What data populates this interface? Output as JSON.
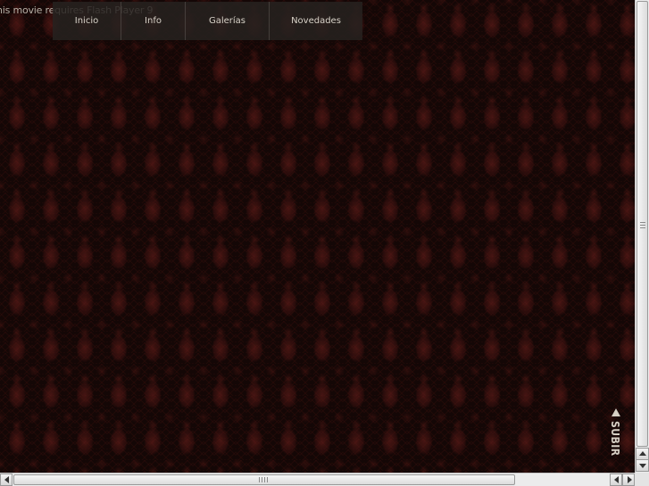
{
  "flash_notice": "his movie requires Flash Player 9",
  "nav": {
    "items": [
      {
        "label": "Inicio"
      },
      {
        "label": "Info"
      },
      {
        "label": "Galerías"
      },
      {
        "label": "Novedades"
      }
    ]
  },
  "subir": {
    "label": "SUBIR",
    "icon": "up-triangle-icon"
  },
  "colors": {
    "background": "#140706",
    "pattern": "#6e201c",
    "nav_background": "#262220",
    "nav_text": "#d8d2c8"
  }
}
